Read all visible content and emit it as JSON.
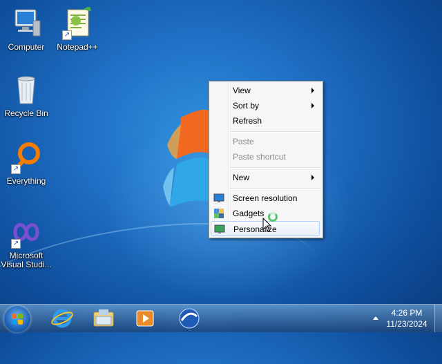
{
  "desktop": {
    "icons": [
      {
        "label": "Computer"
      },
      {
        "label": "Notepad++"
      },
      {
        "label": "Recycle Bin"
      },
      {
        "label": "Everything"
      },
      {
        "label": "Microsoft Visual Studi..."
      }
    ]
  },
  "context_menu": {
    "items": [
      {
        "label": "View",
        "submenu": true,
        "enabled": true
      },
      {
        "label": "Sort by",
        "submenu": true,
        "enabled": true
      },
      {
        "label": "Refresh",
        "enabled": true
      },
      {
        "label": "Paste",
        "enabled": false
      },
      {
        "label": "Paste shortcut",
        "enabled": false
      },
      {
        "label": "New",
        "submenu": true,
        "enabled": true
      },
      {
        "label": "Screen resolution",
        "icon": "screen-resolution-icon",
        "enabled": true
      },
      {
        "label": "Gadgets",
        "icon": "gadgets-icon",
        "enabled": true
      },
      {
        "label": "Personalize",
        "icon": "personalize-icon",
        "enabled": true,
        "highlighted": true
      }
    ]
  },
  "taskbar": {
    "pinned": [
      {
        "icon": "internet-explorer-icon"
      },
      {
        "icon": "file-explorer-icon"
      },
      {
        "icon": "media-player-icon"
      },
      {
        "icon": "browser-icon"
      }
    ],
    "clock": {
      "time": "4:26 PM",
      "date": "11/23/2024"
    }
  },
  "colors": {
    "menu_bg": "#f5f6f7",
    "highlight_border": "#aecff7",
    "disabled_text": "#8d8d8d"
  }
}
